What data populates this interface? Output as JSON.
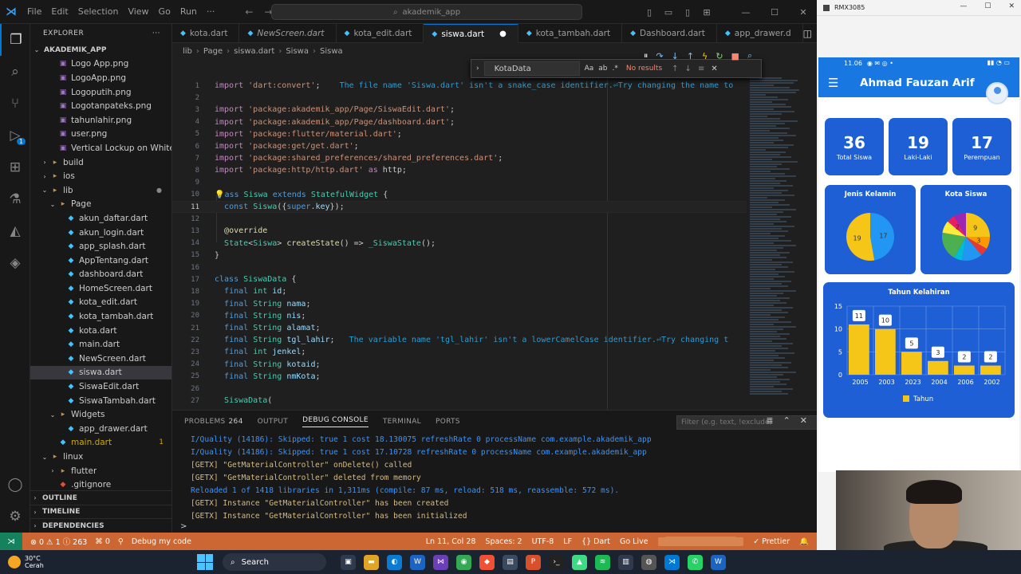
{
  "titlebar": {
    "menu": [
      "File",
      "Edit",
      "Selection",
      "View",
      "Go",
      "Run",
      "···"
    ],
    "search": "akademik_app"
  },
  "activity_badge": "1",
  "explorer": {
    "header": "EXPLORER",
    "project": "AKADEMIK_APP",
    "items": [
      {
        "label": "Logo App.png",
        "type": "img",
        "indent": 2
      },
      {
        "label": "LogoApp.png",
        "type": "img",
        "indent": 2
      },
      {
        "label": "Logoputih.png",
        "type": "img",
        "indent": 2
      },
      {
        "label": "Logotanpateks.png",
        "type": "img",
        "indent": 2
      },
      {
        "label": "tahunlahir.png",
        "type": "img",
        "indent": 2
      },
      {
        "label": "user.png",
        "type": "img",
        "indent": 2
      },
      {
        "label": "Vertical Lockup on White ...",
        "type": "img",
        "indent": 2
      },
      {
        "label": "build",
        "type": "folder",
        "indent": 1,
        "chev": "›"
      },
      {
        "label": "ios",
        "type": "folder",
        "indent": 1,
        "chev": "›"
      },
      {
        "label": "lib",
        "type": "folder",
        "indent": 1,
        "chev": "⌄",
        "dot": true
      },
      {
        "label": "Page",
        "type": "folder",
        "indent": 2,
        "chev": "⌄"
      },
      {
        "label": "akun_daftar.dart",
        "type": "dart",
        "indent": 3
      },
      {
        "label": "akun_login.dart",
        "type": "dart",
        "indent": 3
      },
      {
        "label": "app_splash.dart",
        "type": "dart",
        "indent": 3
      },
      {
        "label": "AppTentang.dart",
        "type": "dart",
        "indent": 3
      },
      {
        "label": "dashboard.dart",
        "type": "dart",
        "indent": 3
      },
      {
        "label": "HomeScreen.dart",
        "type": "dart",
        "indent": 3
      },
      {
        "label": "kota_edit.dart",
        "type": "dart",
        "indent": 3
      },
      {
        "label": "kota_tambah.dart",
        "type": "dart",
        "indent": 3
      },
      {
        "label": "kota.dart",
        "type": "dart",
        "indent": 3
      },
      {
        "label": "main.dart",
        "type": "dart",
        "indent": 3
      },
      {
        "label": "NewScreen.dart",
        "type": "dart",
        "indent": 3
      },
      {
        "label": "siswa.dart",
        "type": "dart",
        "indent": 3,
        "selected": true
      },
      {
        "label": "SiswaEdit.dart",
        "type": "dart",
        "indent": 3
      },
      {
        "label": "SiswaTambah.dart",
        "type": "dart",
        "indent": 3
      },
      {
        "label": "Widgets",
        "type": "folder",
        "indent": 2,
        "chev": "⌄"
      },
      {
        "label": "app_drawer.dart",
        "type": "dart",
        "indent": 3
      },
      {
        "label": "main.dart",
        "type": "dart",
        "indent": 2,
        "num": "1",
        "warn": true
      },
      {
        "label": "linux",
        "type": "folder",
        "indent": 1,
        "chev": "⌄"
      },
      {
        "label": "flutter",
        "type": "folder",
        "indent": 2,
        "chev": "›"
      },
      {
        "label": ".gitignore",
        "type": "git",
        "indent": 2
      }
    ],
    "sections": [
      "OUTLINE",
      "TIMELINE",
      "DEPENDENCIES"
    ]
  },
  "tabs": [
    {
      "label": "kota.dart"
    },
    {
      "label": "NewScreen.dart",
      "italic": true
    },
    {
      "label": "kota_edit.dart"
    },
    {
      "label": "siswa.dart",
      "active": true,
      "dirty": "●"
    },
    {
      "label": "kota_tambah.dart"
    },
    {
      "label": "Dashboard.dart"
    },
    {
      "label": "app_drawer.d"
    }
  ],
  "breadcrumb": [
    "lib",
    "Page",
    "siswa.dart",
    "Siswa",
    "Siswa"
  ],
  "find": {
    "value": "KotaData",
    "options": [
      "Aa",
      "ab",
      ".*"
    ],
    "result": "No results"
  },
  "code": [
    {
      "n": "1",
      "html": "<span class='kw2'>import</span> <span class='str'>'dart:convert'</span><span class='pl'>;</span>    <span class='diag'>The file name 'Siswa.dart' isn't a snake_case identifier.⏎Try changing the name to</span>"
    },
    {
      "n": "2",
      "html": ""
    },
    {
      "n": "3",
      "html": "<span class='kw2'>import</span> <span class='str'>'package:akademik_app/Page/SiswaEdit.dart'</span><span class='pl'>;</span>"
    },
    {
      "n": "4",
      "html": "<span class='kw2'>import</span> <span class='str'>'package:akademik_app/Page/dashboard.dart'</span><span class='pl'>;</span>"
    },
    {
      "n": "5",
      "html": "<span class='kw2'>import</span> <span class='str'>'package:flutter/material.dart'</span><span class='pl'>;</span>"
    },
    {
      "n": "6",
      "html": "<span class='kw2'>import</span> <span class='str'>'package:get/get.dart'</span><span class='pl'>;</span>"
    },
    {
      "n": "7",
      "html": "<span class='kw2'>import</span> <span class='str'>'package:shared_preferences/shared_preferences.dart'</span><span class='pl'>;</span>"
    },
    {
      "n": "8",
      "html": "<span class='kw2'>import</span> <span class='str'>'package:http/http.dart'</span> <span class='kw2'>as</span> <span class='pl'>http;</span>"
    },
    {
      "n": "9",
      "html": ""
    },
    {
      "n": "10",
      "html": "<span class='ann'>💡</span><span class='kw'>ass</span> <span class='cls'>Siswa</span> <span class='kw'>extends</span> <span class='cls'>StatefulWidget</span> <span class='pl'>{</span>"
    },
    {
      "n": "11",
      "html": "  <span class='kw'>const</span> <span class='cls'>Siswa</span><span class='pl'>({</span><span class='kw'>super</span><span class='pl'>.</span><span class='var'>key</span><span class='pl'>});</span>",
      "cur": true
    },
    {
      "n": "12",
      "html": ""
    },
    {
      "n": "13",
      "html": "  <span class='ann'>@override</span>"
    },
    {
      "n": "14",
      "html": "  <span class='cls'>State</span><span class='pl'>&lt;</span><span class='cls'>Siswa</span><span class='pl'>&gt;</span> <span class='fn'>createState</span><span class='pl'>() =&gt; </span><span class='cls'>_SiswaState</span><span class='pl'>();</span>"
    },
    {
      "n": "15",
      "html": "<span class='pl'>}</span>"
    },
    {
      "n": "16",
      "html": ""
    },
    {
      "n": "17",
      "html": "<span class='kw'>class</span> <span class='cls'>SiswaData</span> <span class='pl'>{</span>"
    },
    {
      "n": "18",
      "html": "  <span class='kw'>final</span> <span class='typ'>int</span> <span class='var'>id</span><span class='pl'>;</span>"
    },
    {
      "n": "19",
      "html": "  <span class='kw'>final</span> <span class='typ'>String</span> <span class='var'>nama</span><span class='pl'>;</span>"
    },
    {
      "n": "20",
      "html": "  <span class='kw'>final</span> <span class='typ'>String</span> <span class='var'>nis</span><span class='pl'>;</span>"
    },
    {
      "n": "21",
      "html": "  <span class='kw'>final</span> <span class='typ'>String</span> <span class='var'>alamat</span><span class='pl'>;</span>"
    },
    {
      "n": "22",
      "html": "  <span class='kw'>final</span> <span class='typ'>String</span> <span class='var'>tgl_lahir</span><span class='pl'>;</span>   <span class='diag'>The variable name 'tgl_lahir' isn't a lowerCamelCase identifier.⏎Try changing t</span>"
    },
    {
      "n": "23",
      "html": "  <span class='kw'>final</span> <span class='typ'>int</span> <span class='var'>jenkel</span><span class='pl'>;</span>"
    },
    {
      "n": "24",
      "html": "  <span class='kw'>final</span> <span class='typ'>String</span> <span class='var'>kotaid</span><span class='pl'>;</span>"
    },
    {
      "n": "25",
      "html": "  <span class='kw'>final</span> <span class='typ'>String</span> <span class='var'>nmKota</span><span class='pl'>;</span>"
    },
    {
      "n": "26",
      "html": ""
    },
    {
      "n": "27",
      "html": "  <span class='cls'>SiswaData</span><span class='pl'>(</span>"
    }
  ],
  "panel": {
    "tabs": [
      "PROBLEMS",
      "OUTPUT",
      "DEBUG CONSOLE",
      "TERMINAL",
      "PORTS"
    ],
    "problems_count": "264",
    "active_tab": "DEBUG CONSOLE",
    "filter_placeholder": "Filter (e.g. text, !exclude)",
    "lines": [
      {
        "text": "I/Quality (14186): Skipped: true 1 cost 18.130075 refreshRate 0 processName com.example.akademik_app",
        "color": "blue"
      },
      {
        "text": "I/Quality (14186): Skipped: true 1 cost 17.10728 refreshRate 0 processName com.example.akademik_app",
        "color": "blue"
      },
      {
        "text": "[GETX] \"GetMaterialController\" onDelete() called",
        "color": "orange"
      },
      {
        "text": "[GETX] \"GetMaterialController\" deleted from memory",
        "color": "orange"
      },
      {
        "text": "Reloaded 1 of 1418 libraries in 1,311ms (compile: 87 ms, reload: 518 ms, reassemble: 572 ms).",
        "color": "blue"
      },
      {
        "text": "[GETX] Instance \"GetMaterialController\" has been created",
        "color": "orange"
      },
      {
        "text": "[GETX] Instance \"GetMaterialController\" has been initialized",
        "color": "orange"
      }
    ],
    "prompt": ">"
  },
  "statusbar": {
    "errors": "⊗ 0 ⚠ 1 ⓘ 263",
    "ports": "⌘ 0",
    "debug": "Debug my code",
    "position": "Ln 11, Col 28",
    "spaces": "Spaces: 2",
    "encoding": "UTF-8",
    "eol": "LF",
    "language": "{} Dart",
    "golive": "Go Live",
    "prettier": "✓ Prettier"
  },
  "taskbar": {
    "temp": "30°C",
    "weather": "Cerah",
    "search": "Search"
  },
  "emulator": {
    "window_title": "RMX3085",
    "time": "11.06",
    "app_title": "Ahmad Fauzan Arif",
    "stats": [
      {
        "value": "36",
        "label": "Total Siswa"
      },
      {
        "value": "19",
        "label": "Laki-Laki"
      },
      {
        "value": "17",
        "label": "Perempuan"
      }
    ],
    "pie_titles": [
      "Jenis Kelamin",
      "Kota Siswa"
    ],
    "bar_title": "Tahun Kelahiran",
    "bar_legend": "Tahun"
  },
  "colors": {
    "accent": "#0078d4",
    "statusbar": "#cc6633",
    "app_primary": "#1877e0",
    "card": "#1e5fd6",
    "bar": "#f5c518"
  },
  "chart_data": [
    {
      "type": "pie",
      "title": "Jenis Kelamin",
      "categories": [
        "17",
        "19"
      ],
      "values": [
        17,
        19
      ],
      "colors": [
        "#2196f3",
        "#f5c518"
      ]
    },
    {
      "type": "pie",
      "title": "Kota Siswa",
      "values": [
        9,
        3,
        2,
        5,
        2,
        7,
        3,
        2,
        3
      ],
      "labels": [
        "9",
        "3",
        "",
        "",
        "",
        "",
        "",
        "2",
        ""
      ],
      "colors": [
        "#f5c518",
        "#ff9800",
        "#e53935",
        "#2196f3",
        "#00bcd4",
        "#4caf50",
        "#ffeb3b",
        "#e91e63",
        "#9c27b0"
      ]
    },
    {
      "type": "bar",
      "title": "Tahun Kelahiran",
      "categories": [
        "2005",
        "2003",
        "2023",
        "2004",
        "2006",
        "2002"
      ],
      "values": [
        11,
        10,
        5,
        3,
        2,
        2
      ],
      "ylim": [
        0,
        15
      ],
      "yticks": [
        0,
        5,
        10,
        15
      ],
      "legend": "Tahun",
      "grid": true
    }
  ]
}
